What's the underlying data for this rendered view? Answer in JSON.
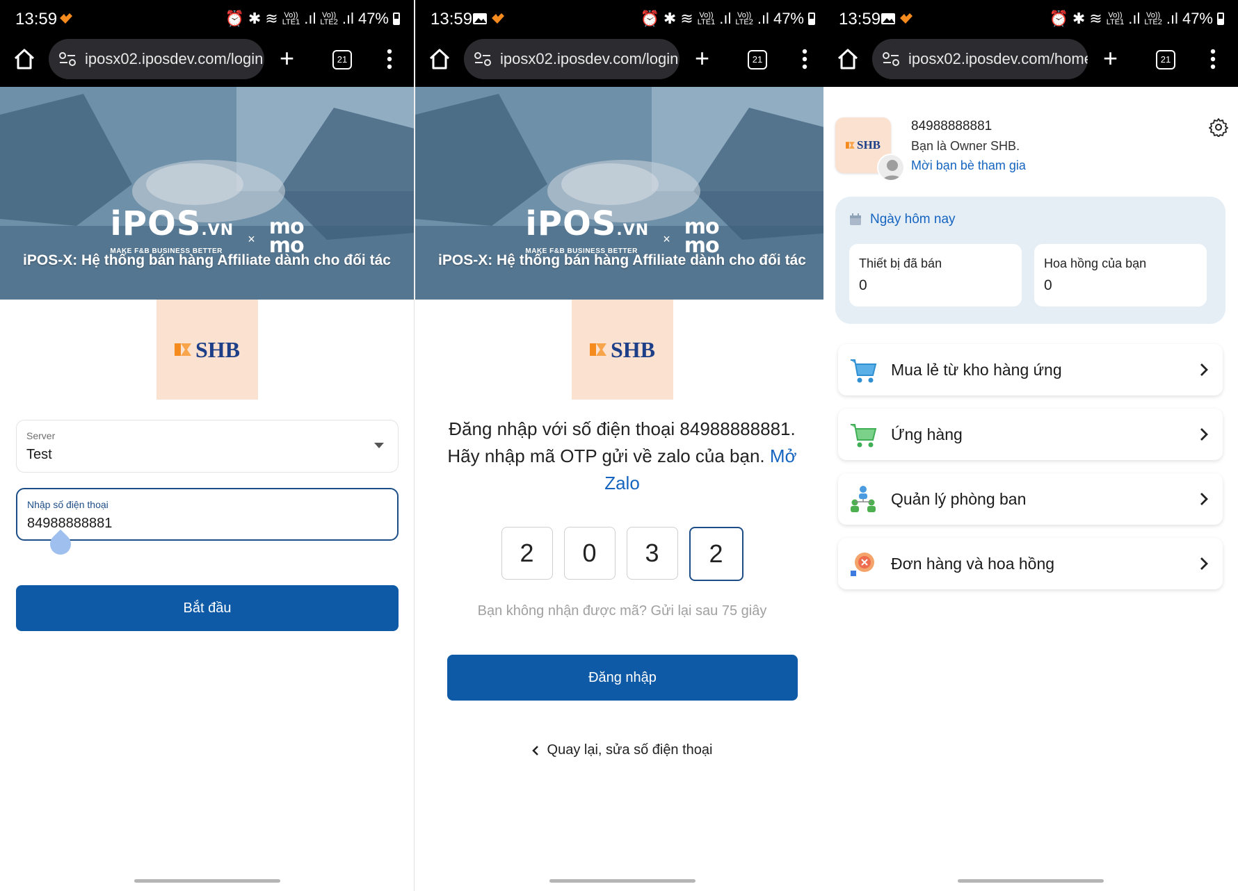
{
  "status_bar": {
    "time": "13:59",
    "battery": "47%",
    "lte1": "LTE1",
    "lte2": "LTE2",
    "volte": "Vo))"
  },
  "browser": {
    "tab_count": "21",
    "url_login": "iposx02.iposdev.com/login",
    "url_home": "iposx02.iposdev.com/home"
  },
  "banner": {
    "ipos_logo": "iPOS",
    "ipos_suffix": ".VN",
    "ipos_tagline": "MAKE F&B BUSINESS BETTER",
    "times": "×",
    "momo_line1": "mo",
    "momo_line2": "mo",
    "caption": "iPOS-X: Hệ thống bán hàng Affiliate dành cho đối tác"
  },
  "brand": {
    "shb": "SHB"
  },
  "login": {
    "server_label": "Server",
    "server_value": "Test",
    "phone_label": "Nhập số điện thoại",
    "phone_value": "84988888881",
    "start_button": "Bắt đầu"
  },
  "otp": {
    "message_prefix": "Đăng nhập với số điện thoại 84988888881. Hãy nhập mã OTP gửi về zalo của bạn. ",
    "open_zalo": "Mở Zalo",
    "digits": [
      "2",
      "0",
      "3",
      "2"
    ],
    "resend": "Bạn không nhận được mã? Gửi lại sau 75 giây",
    "login_button": "Đăng nhập",
    "back_link": "Quay lại, sửa số điện thoại"
  },
  "home": {
    "phone": "84988888881",
    "role": "Bạn là Owner SHB.",
    "invite": "Mời bạn bè tham gia",
    "today_title": "Ngày hôm nay",
    "stats": [
      {
        "label": "Thiết bị đã bán",
        "value": "0"
      },
      {
        "label": "Hoa hồng của bạn",
        "value": "0"
      }
    ],
    "menu": [
      {
        "label": "Mua lẻ từ kho hàng ứng",
        "icon": "cart-blue-icon"
      },
      {
        "label": "Ứng hàng",
        "icon": "cart-green-icon"
      },
      {
        "label": "Quản lý phòng ban",
        "icon": "team-icon"
      },
      {
        "label": "Đơn hàng và hoa hồng",
        "icon": "orders-icon"
      }
    ]
  },
  "colors": {
    "primary": "#0f5aa6",
    "link": "#1565c0",
    "focus_border": "#1c4d86",
    "shb_bg": "#fbe1d0",
    "card_bg": "#e5edf5"
  }
}
